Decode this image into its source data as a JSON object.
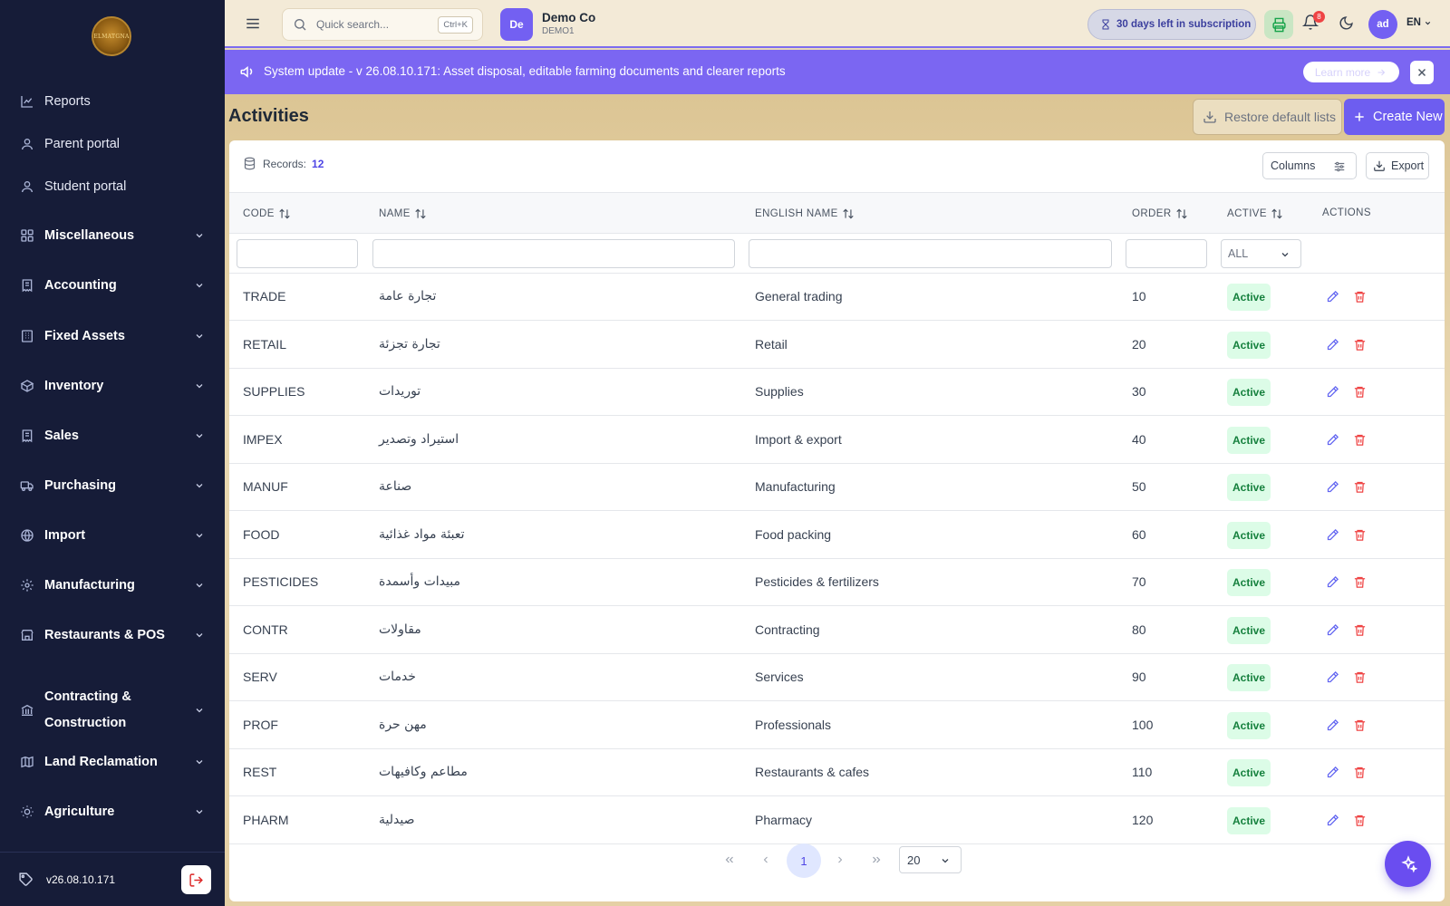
{
  "sidebar": {
    "logo_text": "ELMATGNA",
    "items": [
      {
        "label": "Reports",
        "icon": "chart-line-icon",
        "section": false,
        "expandable": false
      },
      {
        "label": "Parent portal",
        "icon": "user-icon",
        "section": false,
        "expandable": false
      },
      {
        "label": "Student portal",
        "icon": "user-icon",
        "section": false,
        "expandable": false
      },
      {
        "label": "Miscellaneous",
        "icon": "grid-icon",
        "section": true,
        "expandable": true
      },
      {
        "label": "Accounting",
        "icon": "receipt-icon",
        "section": true,
        "expandable": true
      },
      {
        "label": "Fixed Assets",
        "icon": "building-icon",
        "section": true,
        "expandable": true
      },
      {
        "label": "Inventory",
        "icon": "box-icon",
        "section": true,
        "expandable": true
      },
      {
        "label": "Sales",
        "icon": "receipt-icon",
        "section": true,
        "expandable": true
      },
      {
        "label": "Purchasing",
        "icon": "truck-icon",
        "section": true,
        "expandable": true
      },
      {
        "label": "Import",
        "icon": "globe-icon",
        "section": true,
        "expandable": true
      },
      {
        "label": "Manufacturing",
        "icon": "cog-icon",
        "section": true,
        "expandable": true
      },
      {
        "label": "Restaurants & POS",
        "icon": "store-icon",
        "section": true,
        "expandable": true
      },
      {
        "label": "Contracting &",
        "label2": "Construction",
        "icon": "bank-icon",
        "section": true,
        "expandable": true
      },
      {
        "label": "Land Reclamation",
        "icon": "map-icon",
        "section": true,
        "expandable": true
      },
      {
        "label": "Agriculture",
        "icon": "sun-icon",
        "section": true,
        "expandable": true
      }
    ],
    "version": "v26.08.10.171"
  },
  "topbar": {
    "search_placeholder": "Quick search...",
    "search_shortcut": "Ctrl+K",
    "company_initials": "De",
    "company_name": "Demo Co",
    "company_code": "DEMO1",
    "subscription_text": "30 days left in subscription",
    "notifications_count": "8",
    "user_initials": "ad",
    "language": "EN"
  },
  "banner": {
    "message": "System update - v 26.08.10.171: Asset disposal, editable farming documents and clearer reports",
    "learn_more": "Learn more"
  },
  "page": {
    "title": "Activities",
    "restore_label": "Restore default lists",
    "create_label": "Create New"
  },
  "table": {
    "records_label": "Records:",
    "records_count": "12",
    "columns_label": "Columns",
    "export_label": "Export",
    "headers": {
      "code": "CODE",
      "name": "NAME",
      "english_name": "ENGLISH NAME",
      "order": "ORDER",
      "active": "ACTIVE",
      "actions": "ACTIONS"
    },
    "active_filter": "ALL",
    "rows": [
      {
        "code": "TRADE",
        "name": "تجارة عامة",
        "english_name": "General trading",
        "order": "10",
        "status": "Active"
      },
      {
        "code": "RETAIL",
        "name": "تجارة تجزئة",
        "english_name": "Retail",
        "order": "20",
        "status": "Active"
      },
      {
        "code": "SUPPLIES",
        "name": "توريدات",
        "english_name": "Supplies",
        "order": "30",
        "status": "Active"
      },
      {
        "code": "IMPEX",
        "name": "استيراد وتصدير",
        "english_name": "Import & export",
        "order": "40",
        "status": "Active"
      },
      {
        "code": "MANUF",
        "name": "صناعة",
        "english_name": "Manufacturing",
        "order": "50",
        "status": "Active"
      },
      {
        "code": "FOOD",
        "name": "تعبئة مواد غذائية",
        "english_name": "Food packing",
        "order": "60",
        "status": "Active"
      },
      {
        "code": "PESTICIDES",
        "name": "مبيدات وأسمدة",
        "english_name": "Pesticides & fertilizers",
        "order": "70",
        "status": "Active"
      },
      {
        "code": "CONTR",
        "name": "مقاولات",
        "english_name": "Contracting",
        "order": "80",
        "status": "Active"
      },
      {
        "code": "SERV",
        "name": "خدمات",
        "english_name": "Services",
        "order": "90",
        "status": "Active"
      },
      {
        "code": "PROF",
        "name": "مهن حرة",
        "english_name": "Professionals",
        "order": "100",
        "status": "Active"
      },
      {
        "code": "REST",
        "name": "مطاعم وكافيهات",
        "english_name": "Restaurants & cafes",
        "order": "110",
        "status": "Active"
      },
      {
        "code": "PHARM",
        "name": "صيدلية",
        "english_name": "Pharmacy",
        "order": "120",
        "status": "Active"
      }
    ]
  },
  "pagination": {
    "current_page": "1",
    "page_size": "20"
  },
  "colors": {
    "sidebar_bg": "#161c38",
    "accent": "#6d5df0",
    "banner": "#7b66f2",
    "active_badge_bg": "#dcfce7",
    "active_badge_text": "#15803d",
    "danger": "#ef4444"
  }
}
